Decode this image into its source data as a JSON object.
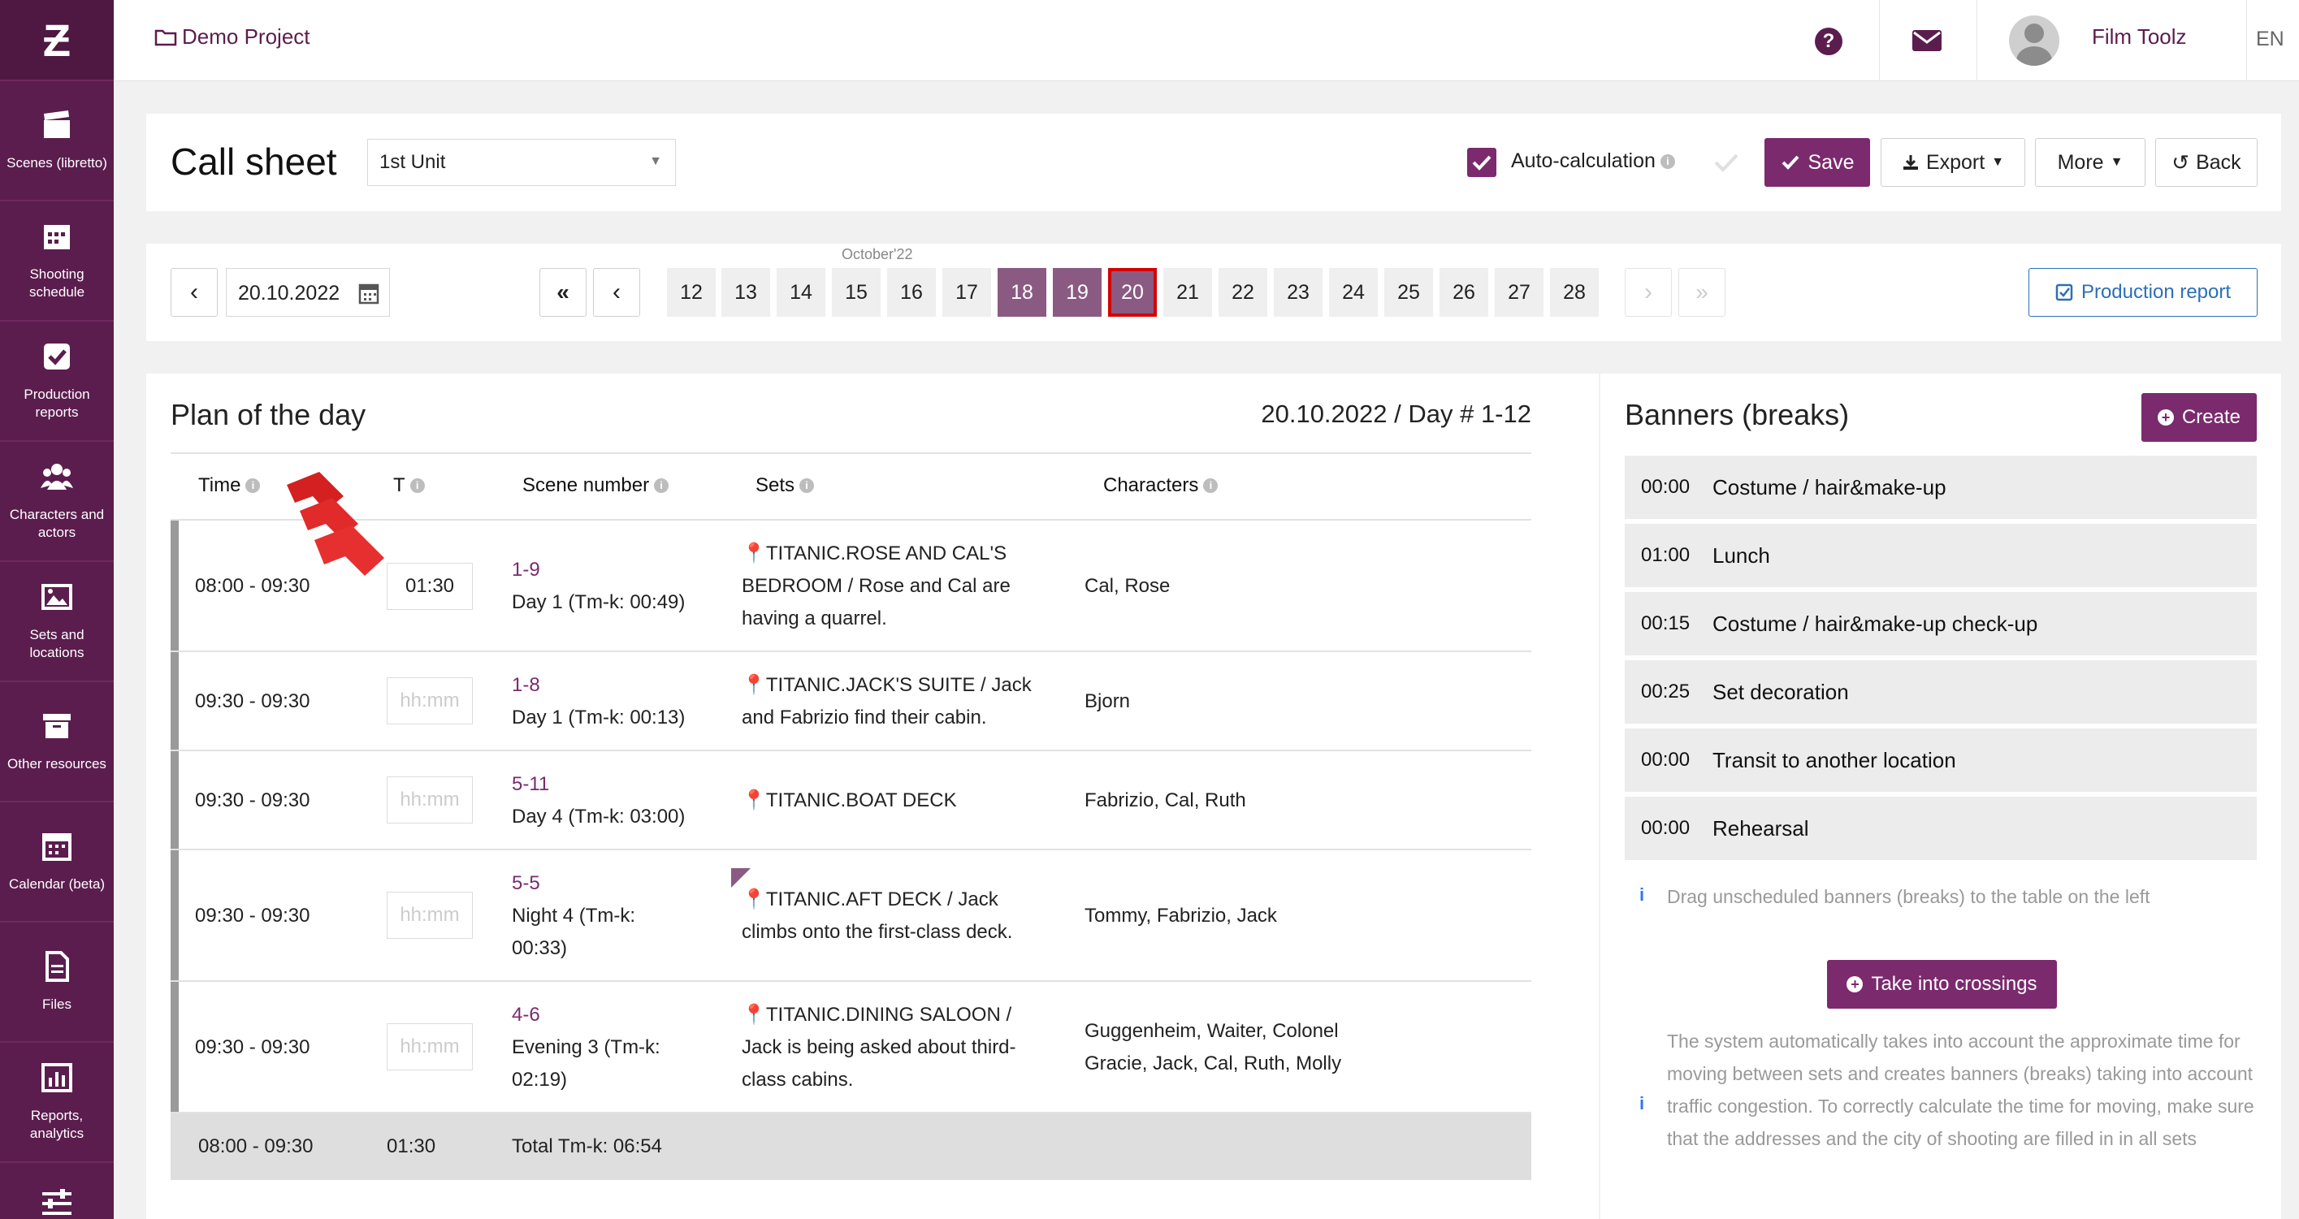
{
  "sidebar": {
    "items": [
      {
        "label": "Scenes (libretto)",
        "icon": "clapperboard-icon"
      },
      {
        "label": "Shooting schedule",
        "icon": "calendar-grid-icon"
      },
      {
        "label": "Production reports",
        "icon": "checkbox-icon"
      },
      {
        "label": "Characters and actors",
        "icon": "people-icon"
      },
      {
        "label": "Sets and locations",
        "icon": "image-icon"
      },
      {
        "label": "Other resources",
        "icon": "archive-box-icon"
      },
      {
        "label": "Calendar (beta)",
        "icon": "calendar-icon"
      },
      {
        "label": "Files",
        "icon": "file-icon"
      },
      {
        "label": "Reports, analytics",
        "icon": "bar-chart-icon"
      }
    ]
  },
  "topbar": {
    "project": "Demo Project",
    "user": "Film Toolz",
    "lang": "EN"
  },
  "header": {
    "title": "Call sheet",
    "unit": "1st Unit",
    "auto_calc": "Auto-calculation",
    "save": "Save",
    "export": "Export",
    "more": "More",
    "back": "Back"
  },
  "datebar": {
    "date": "20.10.2022",
    "month": "October'22",
    "days": [
      "12",
      "13",
      "14",
      "15",
      "16",
      "17",
      "18",
      "19",
      "20",
      "21",
      "22",
      "23",
      "24",
      "25",
      "26",
      "27",
      "28"
    ],
    "production_report": "Production report"
  },
  "plan": {
    "title": "Plan of the day",
    "day_info": "20.10.2022 / Day # 1-12",
    "columns": [
      "Time",
      "T",
      "Scene number",
      "Sets",
      "Characters"
    ],
    "rows": [
      {
        "time": "08:00 - 09:30",
        "t": "01:30",
        "scene": "1-9",
        "scene_desc": "Day 1 (Tm-k: 00:49)",
        "sets": "TITANIC.ROSE AND CAL'S BEDROOM / Rose and Cal are having a quarrel.",
        "chars": "Cal, Rose"
      },
      {
        "time": "09:30 - 09:30",
        "t": "hh:mm",
        "scene": "1-8",
        "scene_desc": "Day 1 (Tm-k: 00:13)",
        "sets": "TITANIC.JACK'S SUITE / Jack and Fabrizio find their cabin.",
        "chars": "Bjorn"
      },
      {
        "time": "09:30 - 09:30",
        "t": "hh:mm",
        "scene": "5-11",
        "scene_desc": "Day 4 (Tm-k: 03:00)",
        "sets": "TITANIC.BOAT DECK",
        "chars": "Fabrizio, Cal, Ruth"
      },
      {
        "time": "09:30 - 09:30",
        "t": "hh:mm",
        "scene": "5-5",
        "scene_desc": "Night 4 (Tm-k: 00:33)",
        "sets": "TITANIC.AFT DECK / Jack climbs onto the first-class deck.",
        "chars": "Tommy, Fabrizio, Jaсk"
      },
      {
        "time": "09:30 - 09:30",
        "t": "hh:mm",
        "scene": "4-6",
        "scene_desc": "Evening 3 (Tm-k: 02:19)",
        "sets": "TITANIC.DINING SALOON / Jack is being asked about third-class cabins.",
        "chars": "Guggenheim, Waiter, Colonel Gracie, Jaсk, Cal, Ruth, Molly"
      }
    ],
    "total": {
      "time": "08:00 - 09:30",
      "t": "01:30",
      "label": "Total Tm-k: 06:54"
    }
  },
  "banners": {
    "title": "Banners (breaks)",
    "create": "Create",
    "items": [
      {
        "time": "00:00",
        "label": "Costume / hair&make-up"
      },
      {
        "time": "01:00",
        "label": "Lunch"
      },
      {
        "time": "00:15",
        "label": "Costume / hair&make-up check-up"
      },
      {
        "time": "00:25",
        "label": "Set decoration"
      },
      {
        "time": "00:00",
        "label": "Transit to another location"
      },
      {
        "time": "00:00",
        "label": "Rehearsal"
      }
    ],
    "drag_note": "Drag unscheduled banners (breaks) to the table on the left",
    "take_crossings": "Take into crossings",
    "system_note": "The system automatically takes into account the approximate time for moving between sets and creates banners (breaks) taking into account traffic congestion. To correctly calculate the time for moving, make sure that the addresses and the city of shooting are filled in in all sets"
  },
  "colors": {
    "brand": "#5b1d4e",
    "accent": "#7b2a6e",
    "selected_outline": "#d40000"
  }
}
